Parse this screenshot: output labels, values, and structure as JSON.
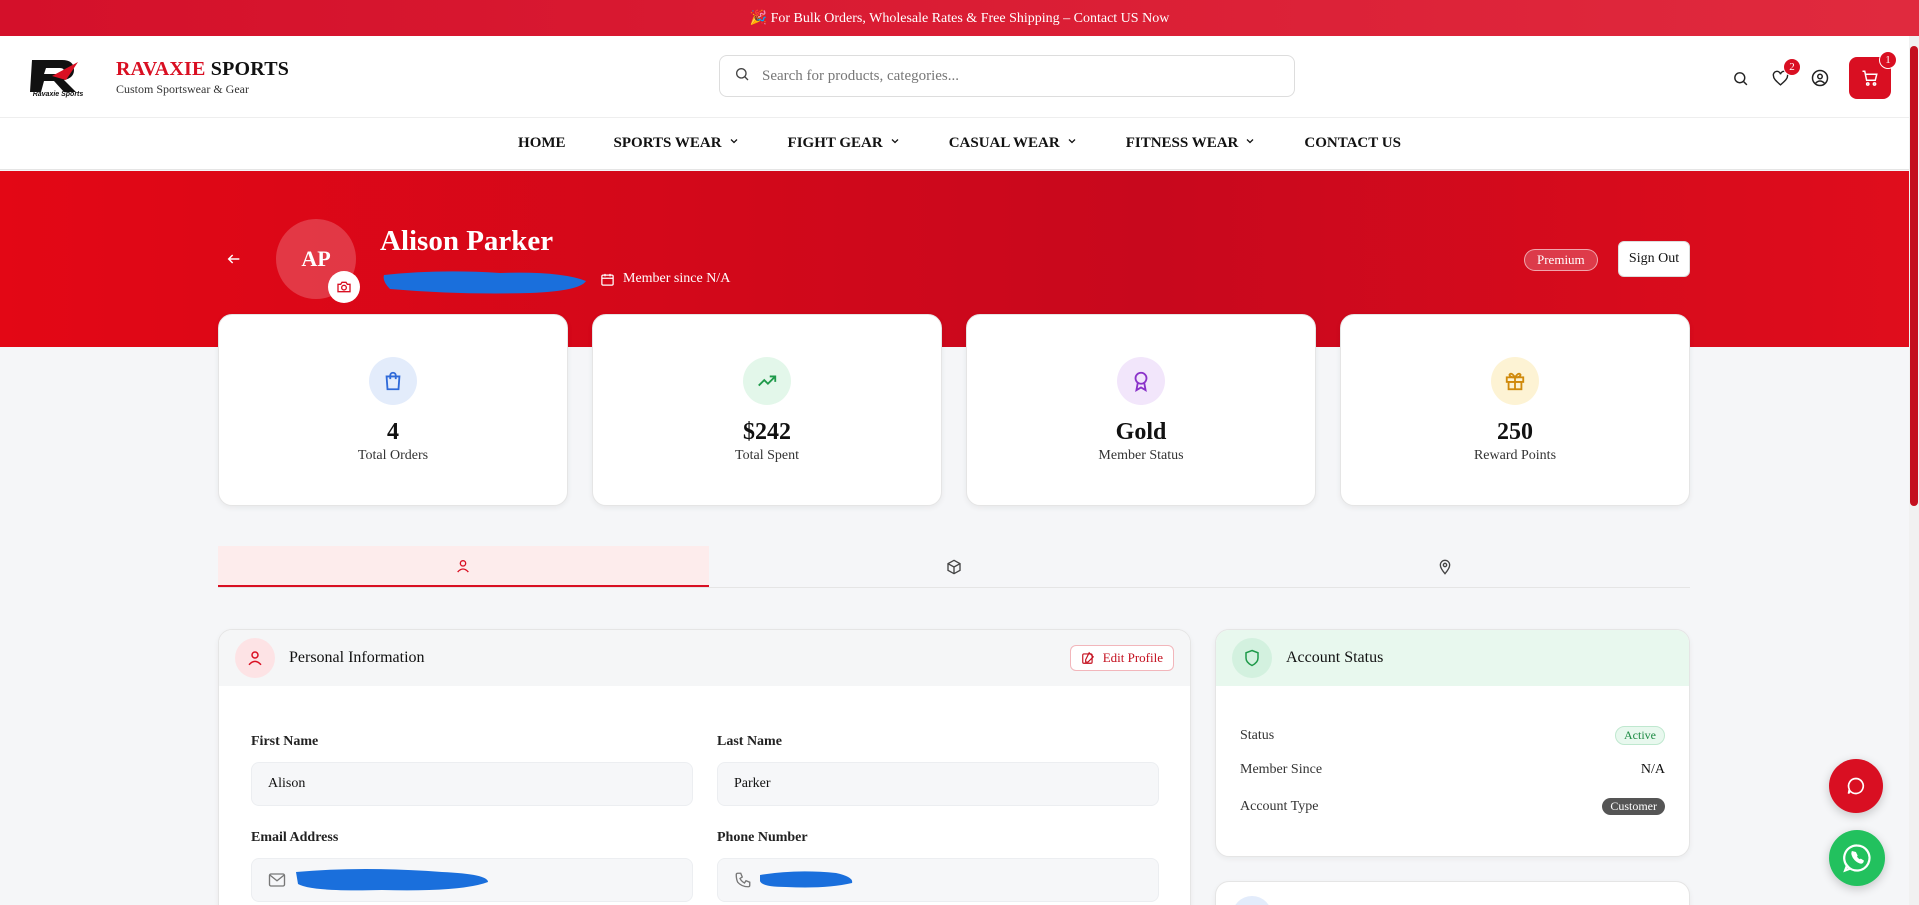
{
  "promo": {
    "text": "🎉 For Bulk Orders, Wholesale Rates & Free Shipping – Contact US Now"
  },
  "brand": {
    "name_part1": "RAVAXIE",
    "name_part2": " SPORTS",
    "tagline": "Custom Sportswear & Gear",
    "logo_text": "Ravaxie Sports"
  },
  "search": {
    "placeholder": "Search for products, categories..."
  },
  "header_icons": {
    "wishlist_count": "2",
    "cart_count": "1"
  },
  "nav": [
    {
      "label": "HOME",
      "dropdown": false
    },
    {
      "label": "SPORTS WEAR",
      "dropdown": true
    },
    {
      "label": "FIGHT GEAR",
      "dropdown": true
    },
    {
      "label": "CASUAL WEAR",
      "dropdown": true
    },
    {
      "label": "FITNESS WEAR",
      "dropdown": true
    },
    {
      "label": "CONTACT US",
      "dropdown": false
    }
  ],
  "profile": {
    "initials": "AP",
    "name": "Alison Parker",
    "member_since": "Member since N/A",
    "tier_badge": "Premium",
    "signout_label": "Sign Out"
  },
  "stats": [
    {
      "value": "4",
      "label": "Total Orders",
      "icon": "shopping-bag-icon",
      "bg": "#e3ecfb",
      "fg": "#2f6ad9"
    },
    {
      "value": "$242",
      "label": "Total Spent",
      "icon": "trending-up-icon",
      "bg": "#e3f7ea",
      "fg": "#1f9a4a"
    },
    {
      "value": "Gold",
      "label": "Member Status",
      "icon": "award-icon",
      "bg": "#f2e6fb",
      "fg": "#8a32c9"
    },
    {
      "value": "250",
      "label": "Reward Points",
      "icon": "gift-icon",
      "bg": "#fdf3d4",
      "fg": "#d08a0c"
    }
  ],
  "personal": {
    "title": "Personal Information",
    "edit_label": "Edit Profile",
    "first_name_label": "First Name",
    "first_name": "Alison",
    "last_name_label": "Last Name",
    "last_name": "Parker",
    "email_label": "Email Address",
    "phone_label": "Phone Number"
  },
  "account": {
    "title": "Account Status",
    "status_label": "Status",
    "status_value": "Active",
    "since_label": "Member Since",
    "since_value": "N/A",
    "type_label": "Account Type",
    "type_value": "Customer"
  },
  "colors": {
    "accent": "#d90f22",
    "success": "#22c15e",
    "redaction": "#1a6fdc"
  }
}
